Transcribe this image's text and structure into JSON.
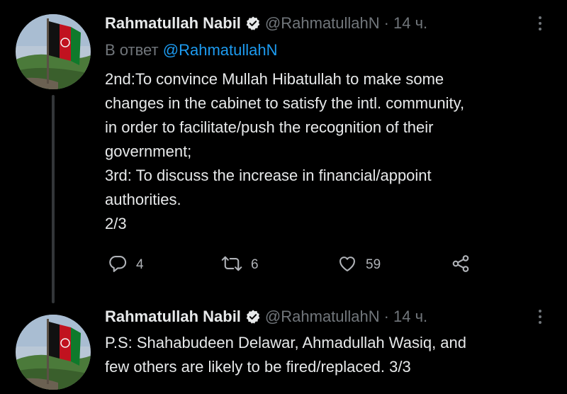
{
  "tweets": [
    {
      "author_name": "Rahmatullah Nabil",
      "handle": "@RahmatullahN",
      "separator": "·",
      "time": "14 ч.",
      "reply_prefix": "В ответ",
      "reply_handle": "@RahmatullahN",
      "lines": [
        "2nd:To convince Mullah Hibatullah to make some",
        "changes in the cabinet to satisfy the intl. community,",
        "in order to facilitate/push the recognition of their",
        "government;",
        "3rd: To discuss the increase in financial/appoint",
        "authorities.",
        "2/3"
      ],
      "actions": {
        "reply_count": "4",
        "retweet_count": "6",
        "like_count": "59"
      }
    },
    {
      "author_name": "Rahmatullah Nabil",
      "handle": "@RahmatullahN",
      "separator": "·",
      "time": "14 ч.",
      "lines": [
        "P.S: Shahabudeen Delawar, Ahmadullah Wasiq, and",
        "few others are likely to be fired/replaced. 3/3"
      ]
    }
  ],
  "icons": {
    "verified": "verified-badge-icon",
    "more": "more-dots-icon",
    "reply": "reply-icon",
    "retweet": "retweet-icon",
    "like": "heart-icon",
    "share": "share-icon"
  },
  "colors": {
    "background": "#000000",
    "text": "#e7e9ea",
    "secondary": "#71767b",
    "link": "#1d9bf0",
    "thread_line": "#333639"
  }
}
